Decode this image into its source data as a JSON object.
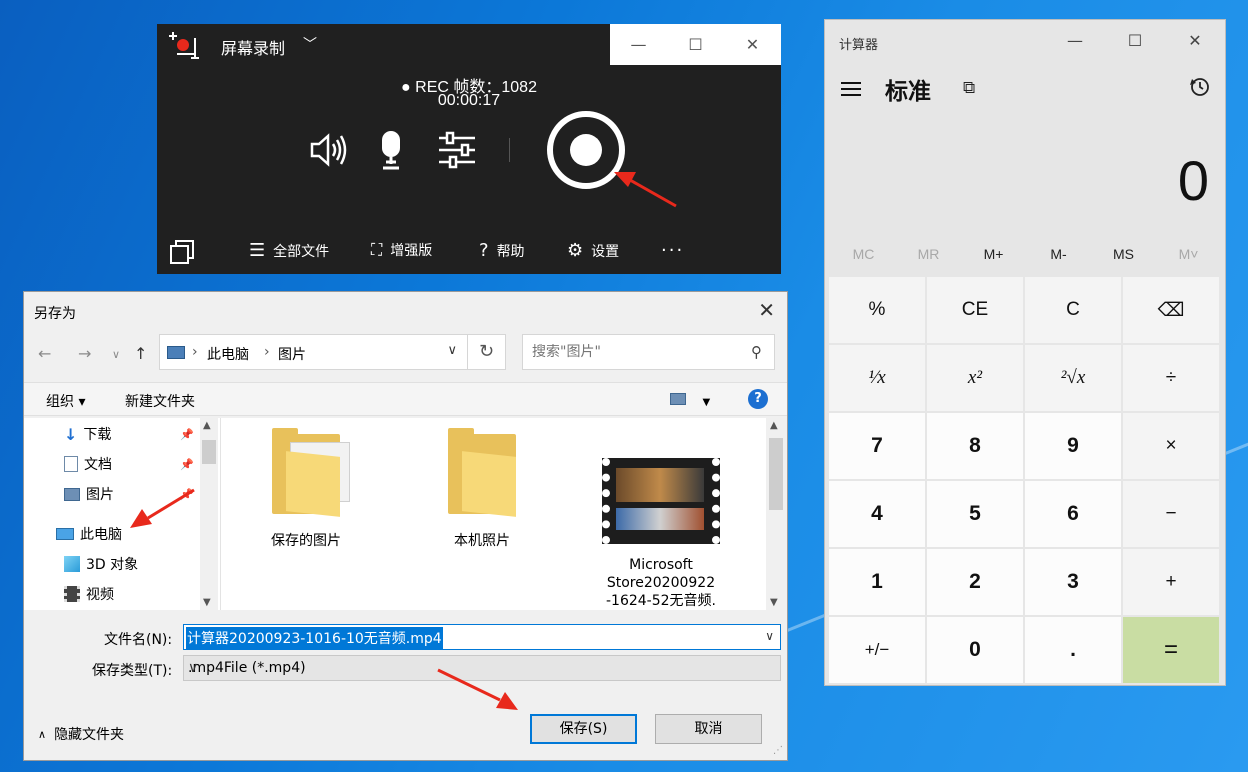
{
  "recorder": {
    "title": "屏幕录制",
    "status_line1": "● REC 帧数：1082",
    "status_line2": "00:00:17",
    "bottom": {
      "all_files": "全部文件",
      "enhanced": "增强版",
      "help": "帮助",
      "settings": "设置",
      "more": "···"
    }
  },
  "calculator": {
    "title": "计算器",
    "mode": "标准",
    "display": "0",
    "memory": [
      "MC",
      "MR",
      "M+",
      "M-",
      "MS",
      "M˅"
    ],
    "keys": [
      "%",
      "CE",
      "C",
      "⌫",
      "¹⁄x",
      "x²",
      "²√x",
      "÷",
      "7",
      "8",
      "9",
      "×",
      "4",
      "5",
      "6",
      "−",
      "1",
      "2",
      "3",
      "+",
      "+/−",
      "0",
      ".",
      "="
    ]
  },
  "dialog": {
    "title": "另存为",
    "breadcrumb": [
      "此电脑",
      "图片"
    ],
    "search_placeholder": "搜索\"图片\"",
    "toolbar": {
      "organize": "组织 ▾",
      "new_folder": "新建文件夹"
    },
    "tree": [
      {
        "label": "下载",
        "icon": "download-icon",
        "pinned": true
      },
      {
        "label": "文档",
        "icon": "document-icon",
        "pinned": true
      },
      {
        "label": "图片",
        "icon": "pictures-icon",
        "pinned": true
      },
      {
        "label": "此电脑",
        "icon": "computer-icon",
        "pinned": false
      },
      {
        "label": "3D 对象",
        "icon": "3d-objects-icon",
        "pinned": false
      },
      {
        "label": "视频",
        "icon": "video-icon",
        "pinned": false
      }
    ],
    "files": [
      {
        "label": "保存的图片",
        "icon": "folder-icon"
      },
      {
        "label": "本机照片",
        "icon": "folder-icon"
      },
      {
        "label_lines": [
          "Microsoft",
          "Store20200922",
          "-1624-52无音频."
        ],
        "icon": "video-thumbnail-icon"
      }
    ],
    "file_name_label": "文件名(N):",
    "file_name_value": "计算器20200923-1016-10无音频.mp4",
    "file_type_label": "保存类型(T):",
    "file_type_value": ".mp4File (*.mp4)",
    "hide_folders": "隐藏文件夹",
    "save_button": "保存(S)",
    "cancel_button": "取消"
  },
  "colors": {
    "accent": "#0078d7",
    "annotation_arrow": "#e8291c",
    "equals_key": "#c9dda3",
    "recorder_bg": "#202020"
  }
}
